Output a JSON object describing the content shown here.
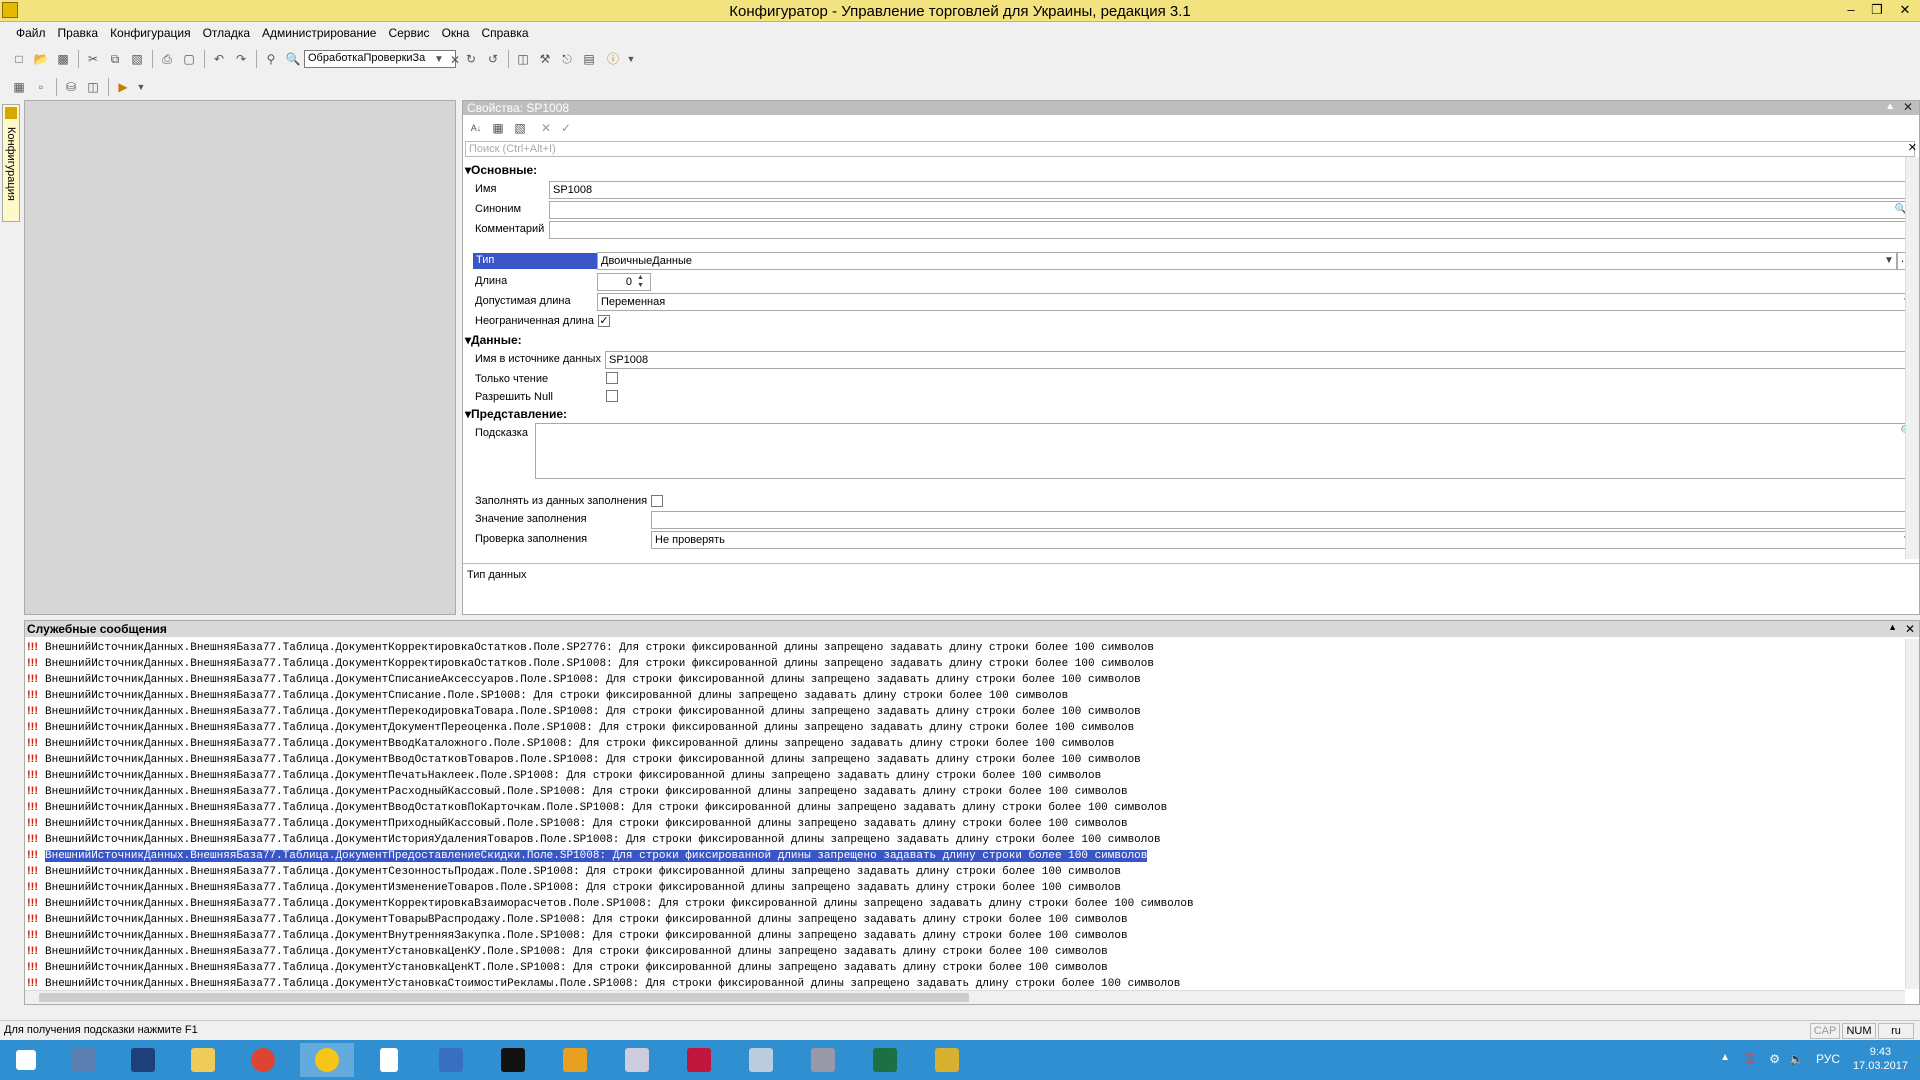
{
  "window": {
    "title": "Конфигуратор - Управление торговлей для Украины, редакция 3.1"
  },
  "menu": [
    "Файл",
    "Правка",
    "Конфигурация",
    "Отладка",
    "Администрирование",
    "Сервис",
    "Окна",
    "Справка"
  ],
  "toolbar": {
    "search_value": "ОбработкаПроверкиЗа"
  },
  "sidebar": {
    "tab_label": "Конфигурация"
  },
  "properties": {
    "header": "Свойства: SP1008",
    "search_placeholder": "Поиск (Ctrl+Alt+I)",
    "section_basic": "Основные:",
    "label_name": "Имя",
    "value_name": "SP1008",
    "label_synonym": "Синоним",
    "value_synonym": "",
    "label_comment": "Комментарий",
    "value_comment": "",
    "label_type": "Тип",
    "value_type": "ДвоичныеДанные",
    "label_length": "Длина",
    "value_length": "0",
    "label_allowed_length": "Допустимая длина",
    "value_allowed_length": "Переменная",
    "label_unlimited": "Неограниченная длина",
    "unlimited_checked": true,
    "section_data": "Данные:",
    "label_source_name": "Имя в источнике данных",
    "value_source_name": "SP1008",
    "label_readonly": "Только чтение",
    "label_allow_null": "Разрешить Null",
    "section_view": "Представление:",
    "label_tooltip": "Подсказка",
    "label_fill_from": "Заполнять из данных заполнения",
    "label_fill_value": "Значение заполнения",
    "label_fill_check": "Проверка заполнения",
    "value_fill_check": "Не проверять",
    "description": "Тип данных"
  },
  "messages": {
    "header": "Служебные сообщения",
    "selected_index": 13,
    "lines": [
      "ВнешнийИсточникДанных.ВнешняяБаза77.Таблица.ДокументКорректировкаОстатков.Поле.SP2776: Для строки фиксированной длины запрещено задавать длину строки более 100 символов",
      "ВнешнийИсточникДанных.ВнешняяБаза77.Таблица.ДокументКорректировкаОстатков.Поле.SP1008: Для строки фиксированной длины запрещено задавать длину строки более 100 символов",
      "ВнешнийИсточникДанных.ВнешняяБаза77.Таблица.ДокументСписаниеАксессуаров.Поле.SP1008: Для строки фиксированной длины запрещено задавать длину строки более 100 символов",
      "ВнешнийИсточникДанных.ВнешняяБаза77.Таблица.ДокументСписание.Поле.SP1008: Для строки фиксированной длины запрещено задавать длину строки более 100 символов",
      "ВнешнийИсточникДанных.ВнешняяБаза77.Таблица.ДокументПерекодировкаТовара.Поле.SP1008: Для строки фиксированной длины запрещено задавать длину строки более 100 символов",
      "ВнешнийИсточникДанных.ВнешняяБаза77.Таблица.ДокументДокументПереоценка.Поле.SP1008: Для строки фиксированной длины запрещено задавать длину строки более 100 символов",
      "ВнешнийИсточникДанных.ВнешняяБаза77.Таблица.ДокументВводКаталожного.Поле.SP1008: Для строки фиксированной длины запрещено задавать длину строки более 100 символов",
      "ВнешнийИсточникДанных.ВнешняяБаза77.Таблица.ДокументВводОстатковТоваров.Поле.SP1008: Для строки фиксированной длины запрещено задавать длину строки более 100 символов",
      "ВнешнийИсточникДанных.ВнешняяБаза77.Таблица.ДокументПечатьНаклеек.Поле.SP1008: Для строки фиксированной длины запрещено задавать длину строки более 100 символов",
      "ВнешнийИсточникДанных.ВнешняяБаза77.Таблица.ДокументРасходныйКассовый.Поле.SP1008: Для строки фиксированной длины запрещено задавать длину строки более 100 символов",
      "ВнешнийИсточникДанных.ВнешняяБаза77.Таблица.ДокументВводОстатковПоКарточкам.Поле.SP1008: Для строки фиксированной длины запрещено задавать длину строки более 100 символов",
      "ВнешнийИсточникДанных.ВнешняяБаза77.Таблица.ДокументПриходныйКассовый.Поле.SP1008: Для строки фиксированной длины запрещено задавать длину строки более 100 символов",
      "ВнешнийИсточникДанных.ВнешняяБаза77.Таблица.ДокументИсторияУдаленияТоваров.Поле.SP1008: Для строки фиксированной длины запрещено задавать длину строки более 100 символов",
      "ВнешнийИсточникДанных.ВнешняяБаза77.Таблица.ДокументПредоставлениеСкидки.Поле.SP1008: Для строки фиксированной длины запрещено задавать длину строки более 100 символов",
      "ВнешнийИсточникДанных.ВнешняяБаза77.Таблица.ДокументСезонностьПродаж.Поле.SP1008: Для строки фиксированной длины запрещено задавать длину строки более 100 символов",
      "ВнешнийИсточникДанных.ВнешняяБаза77.Таблица.ДокументИзменениеТоваров.Поле.SP1008: Для строки фиксированной длины запрещено задавать длину строки более 100 символов",
      "ВнешнийИсточникДанных.ВнешняяБаза77.Таблица.ДокументКорректировкаВзаиморасчетов.Поле.SP1008: Для строки фиксированной длины запрещено задавать длину строки более 100 символов",
      "ВнешнийИсточникДанных.ВнешняяБаза77.Таблица.ДокументТоварыВРаспродажу.Поле.SP1008: Для строки фиксированной длины запрещено задавать длину строки более 100 символов",
      "ВнешнийИсточникДанных.ВнешняяБаза77.Таблица.ДокументВнутренняяЗакупка.Поле.SP1008: Для строки фиксированной длины запрещено задавать длину строки более 100 символов",
      "ВнешнийИсточникДанных.ВнешняяБаза77.Таблица.ДокументУстановкаЦенКУ.Поле.SP1008: Для строки фиксированной длины запрещено задавать длину строки более 100 символов",
      "ВнешнийИсточникДанных.ВнешняяБаза77.Таблица.ДокументУстановкаЦенКТ.Поле.SP1008: Для строки фиксированной длины запрещено задавать длину строки более 100 символов",
      "ВнешнийИсточникДанных.ВнешняяБаза77.Таблица.ДокументУстановкаСтоимостиРекламы.Поле.SP1008: Для строки фиксированной длины запрещено задавать длину строки более 100 символов"
    ]
  },
  "statusbar": {
    "hint": "Для получения подсказки нажмите F1",
    "cap": "CAP",
    "num": "NUM",
    "lang": "ru"
  },
  "taskbar": {
    "lang": "РУС",
    "time": "9:43",
    "date": "17.03.2017"
  },
  "colors": {
    "titlebar": "#f2e37e",
    "selection": "#3a55c5",
    "taskbar": "#2f8fd0"
  }
}
